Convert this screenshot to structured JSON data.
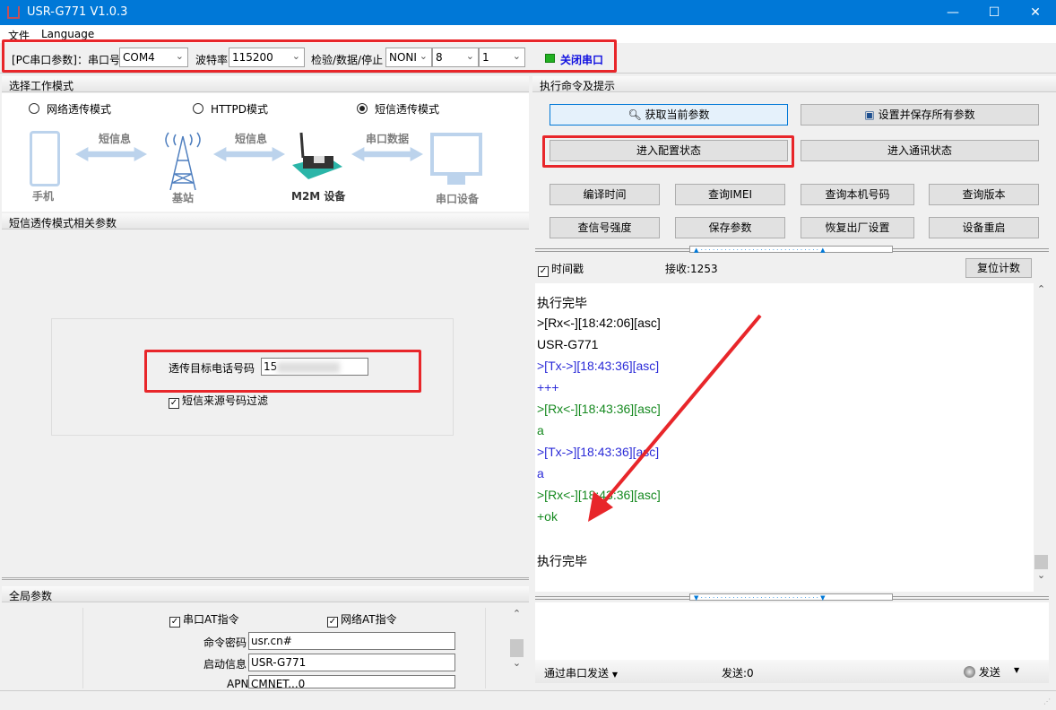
{
  "window": {
    "title": "USR-G771 V1.0.3",
    "minimize": "—",
    "maximize": "☐",
    "close": "✕"
  },
  "menu": [
    "文件",
    "Language"
  ],
  "toolbar": {
    "pc_label": "[PC串口参数]：串口号",
    "port": "COM4",
    "baud_label": "波特率",
    "baud": "115200",
    "parity_label": "检验/数据/停止",
    "parity": "NONI",
    "data_bits": "8",
    "stop_bits": "1",
    "close_port": "关闭串口",
    "status_color": "#22b022"
  },
  "mode_section": {
    "title": "选择工作模式",
    "modes": [
      {
        "label": "网络透传模式",
        "selected": false
      },
      {
        "label": "HTTPD模式",
        "selected": false
      },
      {
        "label": "短信透传模式",
        "selected": true
      }
    ],
    "diagram": {
      "phone": "手机",
      "sms1": "短信息",
      "tower": "基站",
      "sms2": "短信息",
      "m2m": "M2M 设备",
      "serial_data": "串口数据",
      "serial_device": "串口设备"
    }
  },
  "sms_section": {
    "title": "短信透传模式相关参数",
    "target_label": "透传目标电话号码",
    "target_value": "15",
    "filter_label": "短信来源号码过滤",
    "filter_checked": true
  },
  "global_section": {
    "title": "全局参数",
    "serial_at": "串口AT指令",
    "network_at": "网络AT指令",
    "cmd_pwd_label": "命令密码",
    "cmd_pwd": "usr.cn#",
    "boot_label": "启动信息",
    "boot": "USR-G771",
    "apn_label": "APN",
    "apn": "CMNET...0"
  },
  "commands": {
    "title": "执行命令及提示",
    "get_params": "获取当前参数",
    "save_all": "设置并保存所有参数",
    "enter_config": "进入配置状态",
    "enter_comm": "进入通讯状态",
    "buttons": [
      "编译时间",
      "查询IMEI",
      "查询本机号码",
      "查询版本",
      "查信号强度",
      "保存参数",
      "恢复出厂设置",
      "设备重启"
    ]
  },
  "receive": {
    "timestamp_label": "时间戳",
    "timestamp_checked": true,
    "count": "接收:1253",
    "reset": "复位计数"
  },
  "log": [
    {
      "text": "执行完毕",
      "color": "#000000"
    },
    {
      "text": ">[Rx<-][18:42:06][asc]",
      "color": "#000000"
    },
    {
      "text": "USR-G771",
      "color": "#000000"
    },
    {
      "text": ">[Tx->][18:43:36][asc]",
      "color": "#2b2bd8"
    },
    {
      "text": "+++",
      "color": "#2b2bd8"
    },
    {
      "text": ">[Rx<-][18:43:36][asc]",
      "color": "#15891f"
    },
    {
      "text": "a",
      "color": "#15891f"
    },
    {
      "text": ">[Tx->][18:43:36][asc]",
      "color": "#2b2bd8"
    },
    {
      "text": "a",
      "color": "#2b2bd8"
    },
    {
      "text": ">[Rx<-][18:43:36][asc]",
      "color": "#15891f"
    },
    {
      "text": "+ok",
      "color": "#15891f"
    },
    {
      "text": "",
      "color": "#000000"
    },
    {
      "text": "执行完毕",
      "color": "#000000"
    }
  ],
  "send": {
    "via": "通过串口发送",
    "count": "发送:0",
    "send": "发送"
  },
  "colors": {
    "highlight": "#e8262a",
    "titlebar": "#0078d7"
  }
}
